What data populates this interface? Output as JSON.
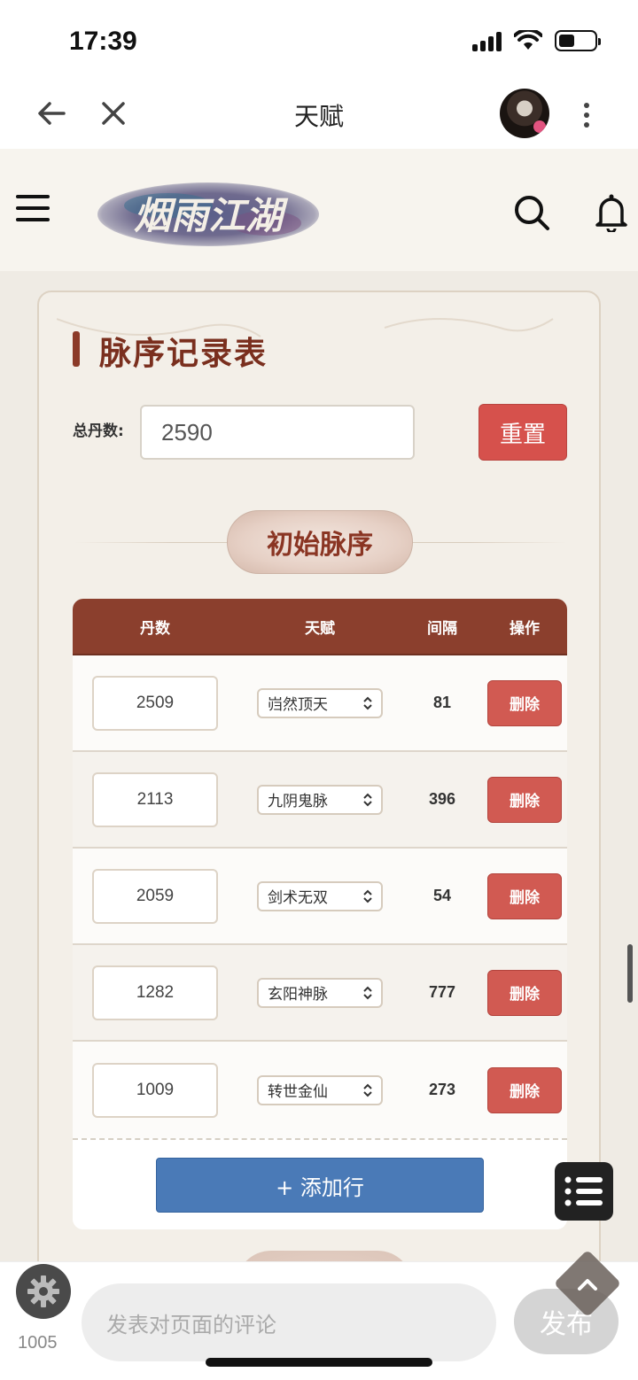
{
  "status": {
    "time": "17:39"
  },
  "browser": {
    "title": "天赋"
  },
  "site": {
    "logo_text": "烟雨江湖"
  },
  "card": {
    "title": "脉序记录表",
    "total_label": "总丹数:",
    "total_value": "2590",
    "reset_label": "重置",
    "section_title": "初始脉序",
    "table": {
      "headers": {
        "dan": "丹数",
        "talent": "天赋",
        "gap": "间隔",
        "action": "操作"
      },
      "rows": [
        {
          "dan": "2509",
          "talent": "岿然顶天",
          "gap": "81",
          "delete": "删除"
        },
        {
          "dan": "2113",
          "talent": "九阴鬼脉",
          "gap": "396",
          "delete": "删除"
        },
        {
          "dan": "2059",
          "talent": "剑术无双",
          "gap": "54",
          "delete": "删除"
        },
        {
          "dan": "1282",
          "talent": "玄阳神脉",
          "gap": "777",
          "delete": "删除"
        },
        {
          "dan": "1009",
          "talent": "转世金仙",
          "gap": "273",
          "delete": "删除"
        }
      ],
      "add_row_label": "+ 添加行"
    }
  },
  "bottom": {
    "count": "1005",
    "comment_placeholder": "发表对页面的评论",
    "publish_label": "发布"
  }
}
